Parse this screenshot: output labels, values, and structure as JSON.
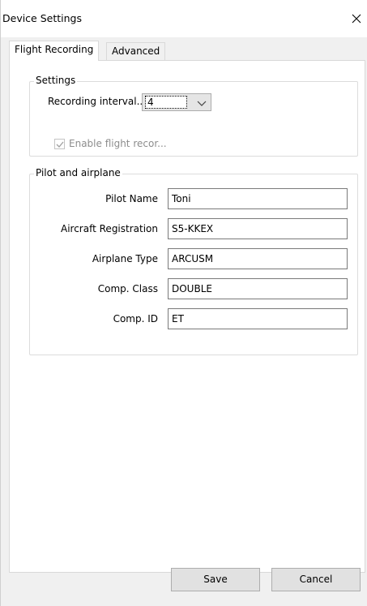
{
  "window": {
    "title": "Device Settings"
  },
  "tabs": [
    {
      "label": "Flight Recording",
      "active": true
    },
    {
      "label": "Advanced",
      "active": false
    }
  ],
  "settings_group": {
    "title": "Settings",
    "recording_interval_label": "Recording interval...",
    "recording_interval_value": "4",
    "enable_checkbox_label": "Enable flight recor...",
    "enable_checked": true,
    "enable_disabled": true
  },
  "pilot_group": {
    "title": "Pilot and airplane",
    "fields": [
      {
        "label": "Pilot Name",
        "value": "Toni"
      },
      {
        "label": "Aircraft Registration",
        "value": "S5-KKEX"
      },
      {
        "label": "Airplane Type",
        "value": "ARCUSM"
      },
      {
        "label": "Comp. Class",
        "value": "DOUBLE"
      },
      {
        "label": "Comp. ID",
        "value": "ET"
      }
    ]
  },
  "buttons": {
    "save": "Save",
    "cancel": "Cancel"
  },
  "icons": {
    "close": "close-icon",
    "dropdown": "chevron-down-icon",
    "check": "checkmark-icon"
  }
}
